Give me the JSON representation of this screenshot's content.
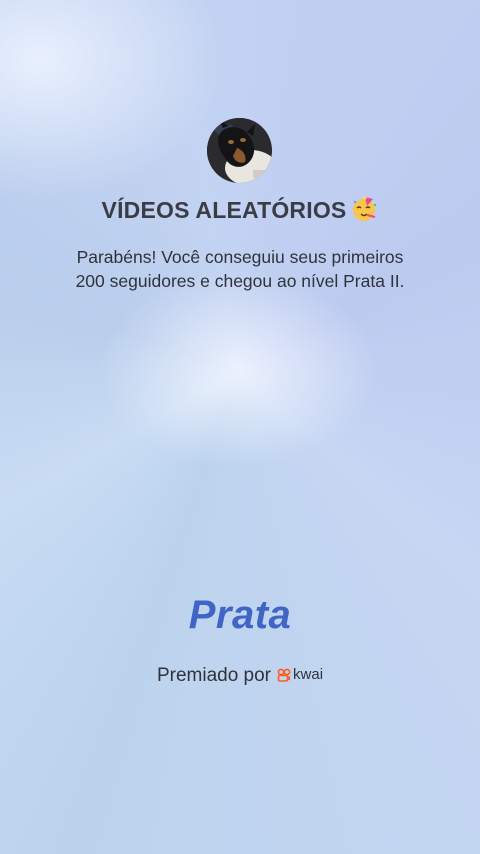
{
  "profile": {
    "avatar_icon": "dog-photo-avatar",
    "name": "VÍDEOS ALEATÓRIOS",
    "name_emoji": "partying-face-emoji"
  },
  "message": {
    "line1": "Parabéns! Você conseguiu seus primeiros",
    "line2": "200 seguidores e chegou ao nível Prata II."
  },
  "level": {
    "label": "Prata",
    "color": "#3f66c4"
  },
  "footer": {
    "awarded_by": "Premiado por",
    "brand_icon": "kwai-logo-icon",
    "brand_name": "kwai",
    "brand_color": "#ff5a1f"
  }
}
